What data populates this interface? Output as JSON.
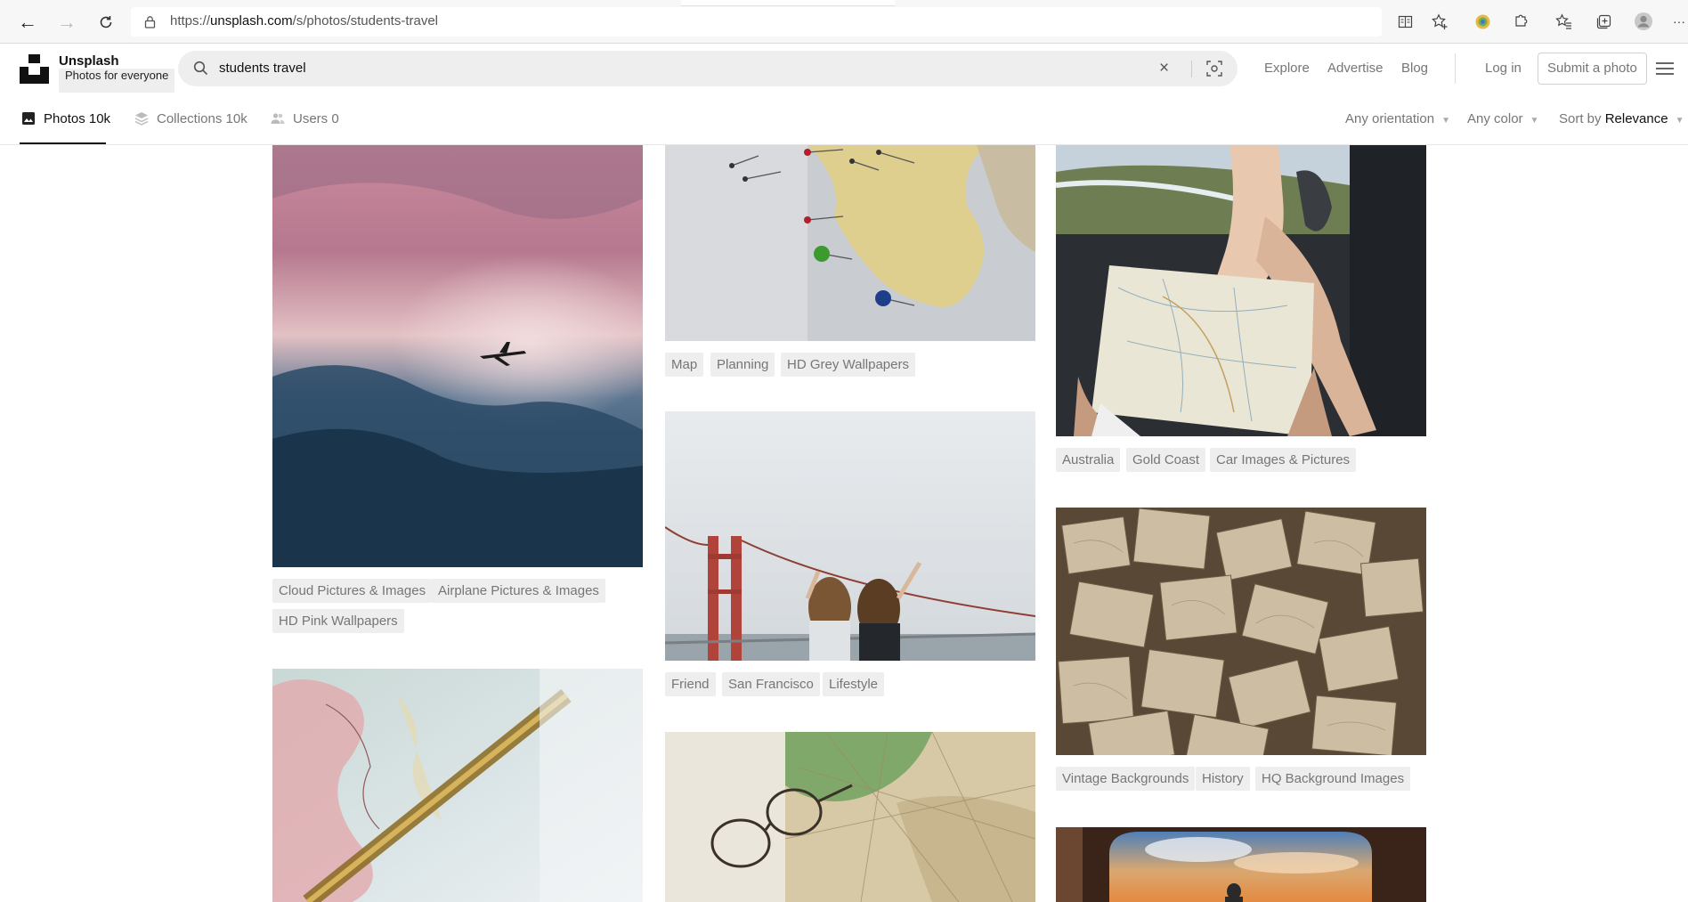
{
  "browser": {
    "url_prefix": "https://",
    "url_domain": "unsplash.com",
    "url_path": "/s/photos/students-travel",
    "more_label": "···"
  },
  "header": {
    "brand_name": "Unsplash",
    "brand_tagline": "Photos for everyone",
    "search_value": "students travel",
    "nav": [
      "Explore",
      "Advertise",
      "Blog"
    ],
    "login_label": "Log in",
    "submit_label": "Submit a photo"
  },
  "filters": {
    "tabs": [
      {
        "label": "Photos 10k",
        "icon": "image-icon"
      },
      {
        "label": "Collections 10k",
        "icon": "collections-icon"
      },
      {
        "label": "Users 0",
        "icon": "users-icon"
      }
    ],
    "orientation_label": "Any orientation",
    "color_label": "Any color",
    "sort_prefix": "Sort by",
    "sort_value": "Relevance"
  },
  "columns": [
    {
      "items": [
        {
          "photo": "airplane-clouds-photo",
          "tags": [
            "Cloud Pictures & Images",
            "Airplane Pictures & Images",
            "HD Pink Wallpapers"
          ]
        },
        {
          "photo": "globe-asia-photo",
          "tags": []
        }
      ]
    },
    {
      "items": [
        {
          "photo": "map-pins-photo",
          "tags": [
            "Map",
            "Planning",
            "HD Grey Wallpapers"
          ]
        },
        {
          "photo": "golden-gate-friends-photo",
          "tags": [
            "Friend",
            "San Francisco",
            "Lifestyle"
          ]
        },
        {
          "photo": "glasses-map-photo",
          "tags": []
        }
      ]
    },
    {
      "items": [
        {
          "photo": "car-map-photo",
          "tags": [
            "Australia",
            "Gold Coast",
            "Car Images & Pictures"
          ]
        },
        {
          "photo": "vintage-maps-photo",
          "tags": [
            "Vintage Backgrounds",
            "History",
            "HQ Background Images"
          ]
        },
        {
          "photo": "sunset-window-photo",
          "tags": []
        }
      ]
    }
  ]
}
